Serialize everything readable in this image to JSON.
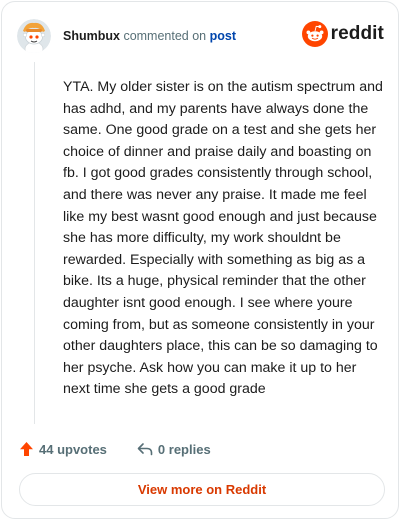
{
  "header": {
    "username": "Shumbux",
    "verb": "commented on",
    "post_link": "post",
    "brand_name": "reddit",
    "brand_color": "#ff4500",
    "avatar_icon": "snoo-avatar-icon",
    "brand_icon": "reddit-logo-icon"
  },
  "comment": {
    "text": "YTA. My older sister is on the autism spectrum and has adhd, and my parents have always done the same. One good grade on a test and she gets her choice of dinner and praise daily and boasting on fb. I got good grades consistently through school, and there was never any praise. It made me feel like my best wasnt good enough and just because she has more difficulty, my work shouldnt be rewarded. Especially with something as big as a bike. Its a huge, physical reminder that the other daughter isnt good enough. I see where youre coming from, but as someone consistently in your other daughters place, this can be so damaging to her psyche. Ask how you can make it up to her next time she gets a good grade"
  },
  "footer": {
    "upvotes": "44 upvotes",
    "replies": "0 replies",
    "upvote_icon": "upvote-arrow-icon",
    "reply_icon": "reply-arrow-icon",
    "upvote_color": "#ff4500"
  },
  "cta": {
    "label": "View more on Reddit",
    "color": "#d93900"
  }
}
